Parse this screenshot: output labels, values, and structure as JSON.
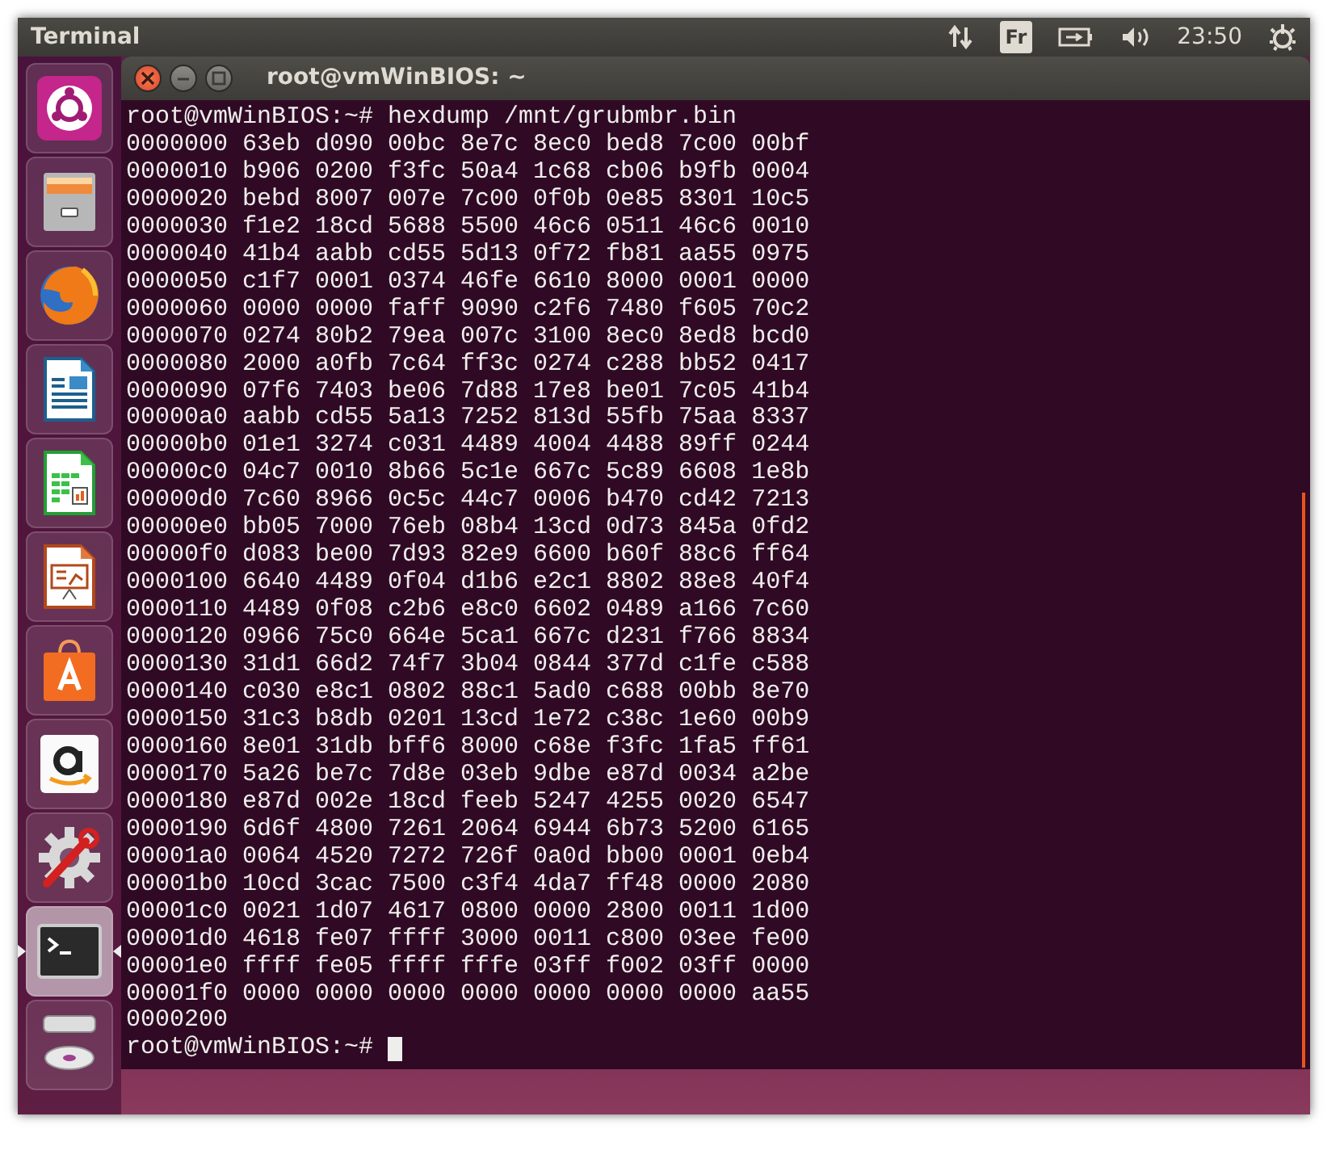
{
  "top_bar": {
    "app_title": "Terminal",
    "keyboard_layout": "Fr",
    "clock": "23:50"
  },
  "launcher": [
    {
      "kind": "dash",
      "selected": false
    },
    {
      "kind": "files",
      "selected": false
    },
    {
      "kind": "browser",
      "selected": false
    },
    {
      "kind": "writer",
      "selected": false
    },
    {
      "kind": "calc",
      "selected": false
    },
    {
      "kind": "impress",
      "selected": false
    },
    {
      "kind": "software",
      "selected": false
    },
    {
      "kind": "shop",
      "selected": false
    },
    {
      "kind": "settings",
      "selected": false
    },
    {
      "kind": "terminal",
      "selected": true
    },
    {
      "kind": "drive",
      "selected": false
    }
  ],
  "window": {
    "title": "root@vmWinBIOS: ~",
    "lines": [
      "root@vmWinBIOS:~# hexdump /mnt/grubmbr.bin",
      "0000000 63eb d090 00bc 8e7c 8ec0 bed8 7c00 00bf",
      "0000010 b906 0200 f3fc 50a4 1c68 cb06 b9fb 0004",
      "0000020 bebd 8007 007e 7c00 0f0b 0e85 8301 10c5",
      "0000030 f1e2 18cd 5688 5500 46c6 0511 46c6 0010",
      "0000040 41b4 aabb cd55 5d13 0f72 fb81 aa55 0975",
      "0000050 c1f7 0001 0374 46fe 6610 8000 0001 0000",
      "0000060 0000 0000 faff 9090 c2f6 7480 f605 70c2",
      "0000070 0274 80b2 79ea 007c 3100 8ec0 8ed8 bcd0",
      "0000080 2000 a0fb 7c64 ff3c 0274 c288 bb52 0417",
      "0000090 07f6 7403 be06 7d88 17e8 be01 7c05 41b4",
      "00000a0 aabb cd55 5a13 7252 813d 55fb 75aa 8337",
      "00000b0 01e1 3274 c031 4489 4004 4488 89ff 0244",
      "00000c0 04c7 0010 8b66 5c1e 667c 5c89 6608 1e8b",
      "00000d0 7c60 8966 0c5c 44c7 0006 b470 cd42 7213",
      "00000e0 bb05 7000 76eb 08b4 13cd 0d73 845a 0fd2",
      "00000f0 d083 be00 7d93 82e9 6600 b60f 88c6 ff64",
      "0000100 6640 4489 0f04 d1b6 e2c1 8802 88e8 40f4",
      "0000110 4489 0f08 c2b6 e8c0 6602 0489 a166 7c60",
      "0000120 0966 75c0 664e 5ca1 667c d231 f766 8834",
      "0000130 31d1 66d2 74f7 3b04 0844 377d c1fe c588",
      "0000140 c030 e8c1 0802 88c1 5ad0 c688 00bb 8e70",
      "0000150 31c3 b8db 0201 13cd 1e72 c38c 1e60 00b9",
      "0000160 8e01 31db bff6 8000 c68e f3fc 1fa5 ff61",
      "0000170 5a26 be7c 7d8e 03eb 9dbe e87d 0034 a2be",
      "0000180 e87d 002e 18cd feeb 5247 4255 0020 6547",
      "0000190 6d6f 4800 7261 2064 6944 6b73 5200 6165",
      "00001a0 0064 4520 7272 726f 0a0d bb00 0001 0eb4",
      "00001b0 10cd 3cac 7500 c3f4 4da7 ff48 0000 2080",
      "00001c0 0021 1d07 4617 0800 0000 2800 0011 1d00",
      "00001d0 4618 fe07 ffff 3000 0011 c800 03ee fe00",
      "00001e0 ffff fe05 ffff fffe 03ff f002 03ff 0000",
      "00001f0 0000 0000 0000 0000 0000 0000 0000 aa55",
      "0000200"
    ],
    "prompt": "root@vmWinBIOS:~#"
  }
}
